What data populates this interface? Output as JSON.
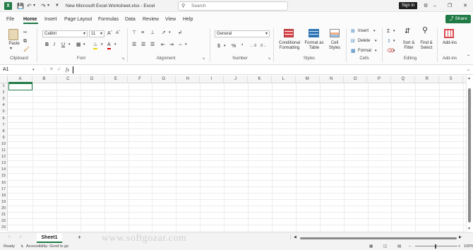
{
  "titlebar": {
    "app_icon_letter": "X",
    "document_title": "New Microsoft Excel Worksheet.xlsx  -  Excel",
    "search_placeholder": "Search",
    "sign_in_label": "Sign in"
  },
  "menu": {
    "tabs": [
      "File",
      "Home",
      "Insert",
      "Page Layout",
      "Formulas",
      "Data",
      "Review",
      "View",
      "Help"
    ],
    "share_label": "Share"
  },
  "ribbon": {
    "clipboard": {
      "paste_label": "Paste",
      "group_label": "Clipboard"
    },
    "font": {
      "font_name": "Calibri",
      "font_size": "11",
      "group_label": "Font"
    },
    "alignment": {
      "group_label": "Alignment"
    },
    "number": {
      "format_value": "General",
      "group_label": "Number"
    },
    "styles": {
      "conditional_formatting_label": "Conditional Formatting",
      "format_as_table_label": "Format as Table",
      "cell_styles_label": "Cell Styles",
      "group_label": "Styles"
    },
    "cells": {
      "insert_label": "Insert",
      "delete_label": "Delete",
      "format_label": "Format",
      "group_label": "Cells"
    },
    "editing": {
      "sort_filter_label": "Sort & Filter",
      "find_select_label": "Find & Select",
      "group_label": "Editing"
    },
    "addins": {
      "addins_label": "Add-ins",
      "group_label": "Add-ins"
    }
  },
  "formula_bar": {
    "name_box_value": "A1",
    "fx_label": "fx",
    "formula_value": ""
  },
  "grid": {
    "columns": [
      "A",
      "B",
      "C",
      "D",
      "E",
      "F",
      "G",
      "H",
      "I",
      "J",
      "K",
      "L",
      "M",
      "N",
      "O",
      "P",
      "Q",
      "R",
      "S"
    ],
    "rows": [
      "1",
      "2",
      "3",
      "4",
      "5",
      "6",
      "7",
      "8",
      "9",
      "10",
      "11",
      "12",
      "13",
      "14",
      "15",
      "16",
      "17",
      "18",
      "19",
      "20",
      "21",
      "22",
      "23"
    ],
    "selected_cell": "A1"
  },
  "sheets": {
    "tabs": [
      "Sheet1"
    ],
    "add_sheet_label": "+"
  },
  "status": {
    "ready_label": "Ready",
    "accessibility_label": "Accessibility: Good to go",
    "zoom_label": "100%"
  },
  "watermark": "www.softgozar.com",
  "colors": {
    "accent": "#1f7a45",
    "signin_bg": "#202020"
  }
}
